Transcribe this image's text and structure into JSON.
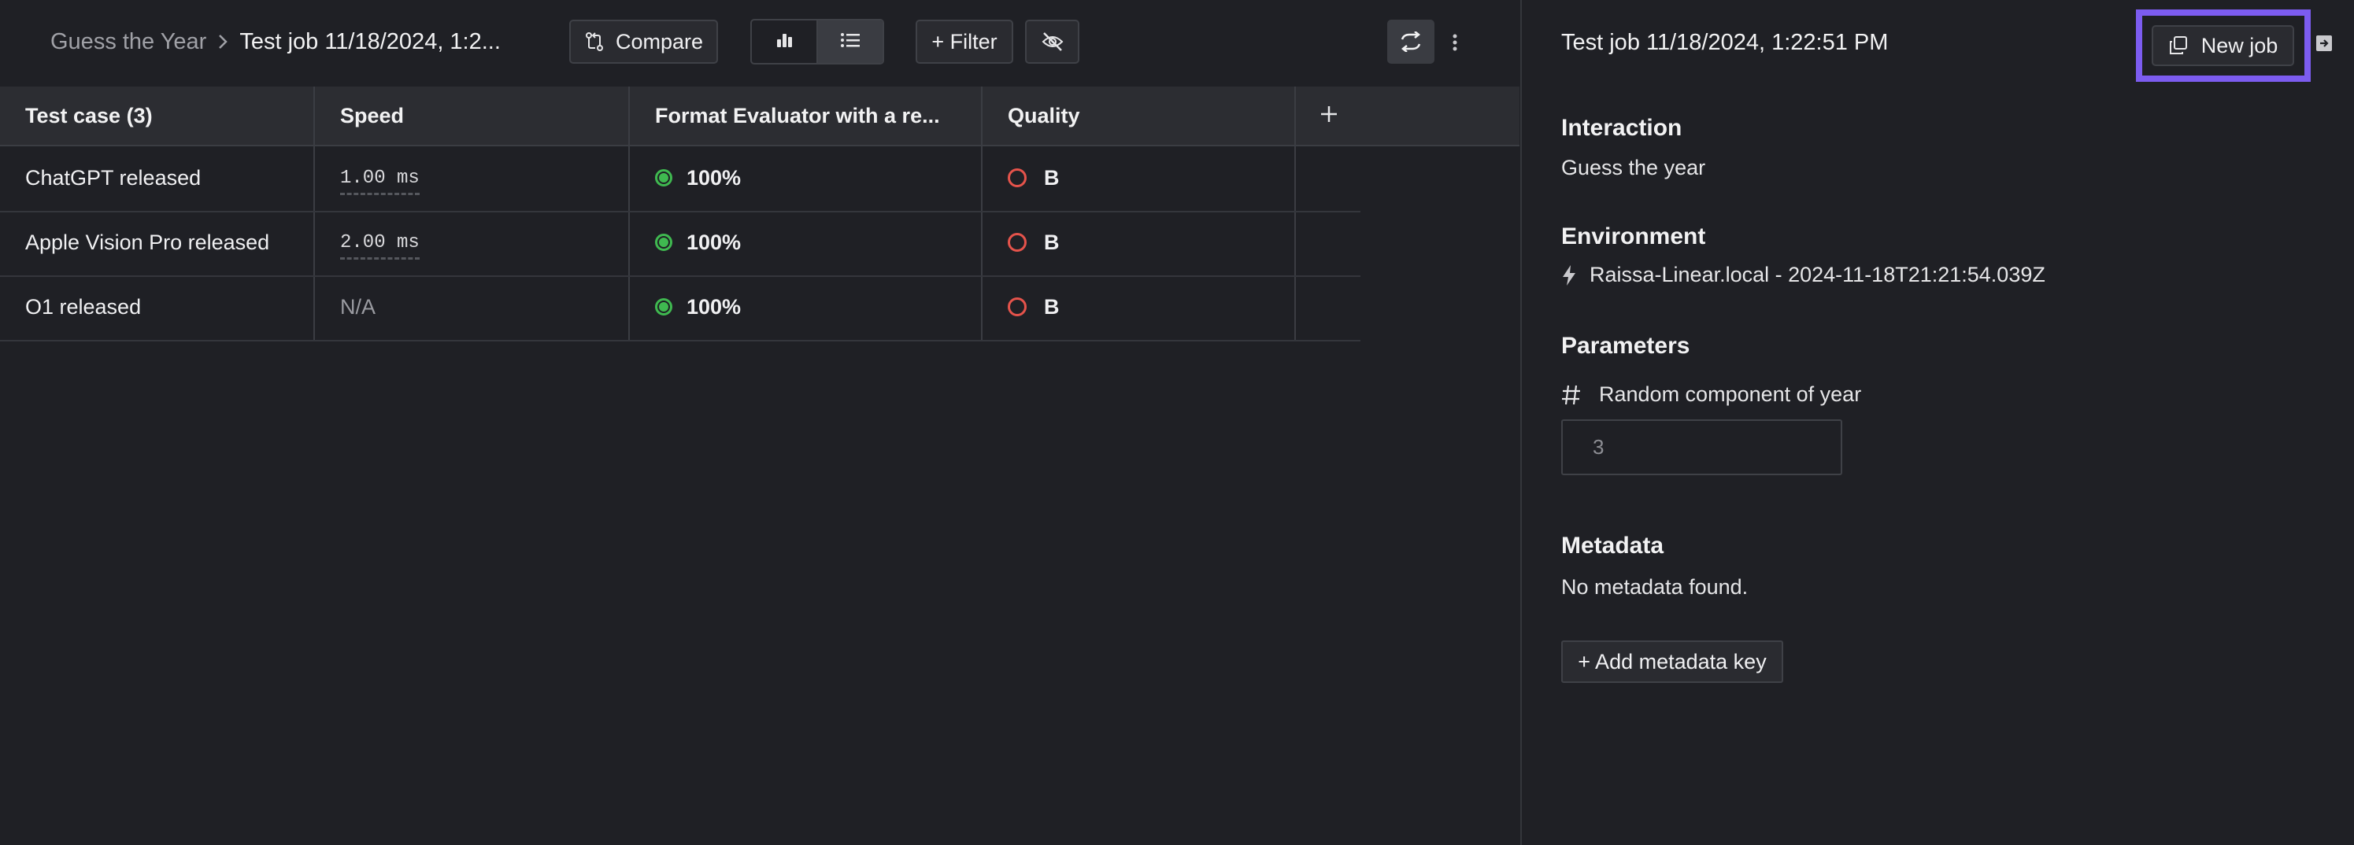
{
  "breadcrumb": {
    "parent": "Guess the Year",
    "current": "Test job 11/18/2024, 1:2..."
  },
  "toolbar": {
    "compare_label": "Compare",
    "filter_label": "+ Filter"
  },
  "table": {
    "columns": [
      "Test case (3)",
      "Speed",
      "Format Evaluator with a re...",
      "Quality"
    ],
    "rows": [
      {
        "test_case": "ChatGPT released",
        "speed": "1.00 ms",
        "format": "100%",
        "quality": "B"
      },
      {
        "test_case": "Apple Vision Pro released",
        "speed": "2.00 ms",
        "format": "100%",
        "quality": "B"
      },
      {
        "test_case": "O1 released",
        "speed": "N/A",
        "format": "100%",
        "quality": "B"
      }
    ]
  },
  "panel": {
    "title": "Test job 11/18/2024, 1:22:51 PM",
    "new_job_label": "New job",
    "interaction": {
      "heading": "Interaction",
      "value": "Guess the year"
    },
    "environment": {
      "heading": "Environment",
      "value": "Raissa-Linear.local - 2024-11-18T21:21:54.039Z"
    },
    "parameters": {
      "heading": "Parameters",
      "param_label": "Random component of year",
      "param_value": "3"
    },
    "metadata": {
      "heading": "Metadata",
      "empty_text": "No metadata found.",
      "add_label": "+ Add metadata key"
    }
  },
  "colors": {
    "background": "#1f2025",
    "header_bg": "#2c2d32",
    "highlight": "#7c5cf0",
    "success": "#3fb950",
    "danger": "#e5534b"
  },
  "icons": [
    "chevron-right-icon",
    "compare-icon",
    "bar-chart-icon",
    "list-icon",
    "eye-off-icon",
    "sync-icon",
    "more-vertical-icon",
    "plus-icon",
    "copy-icon",
    "lightning-icon",
    "hash-icon",
    "panel-close-icon"
  ]
}
